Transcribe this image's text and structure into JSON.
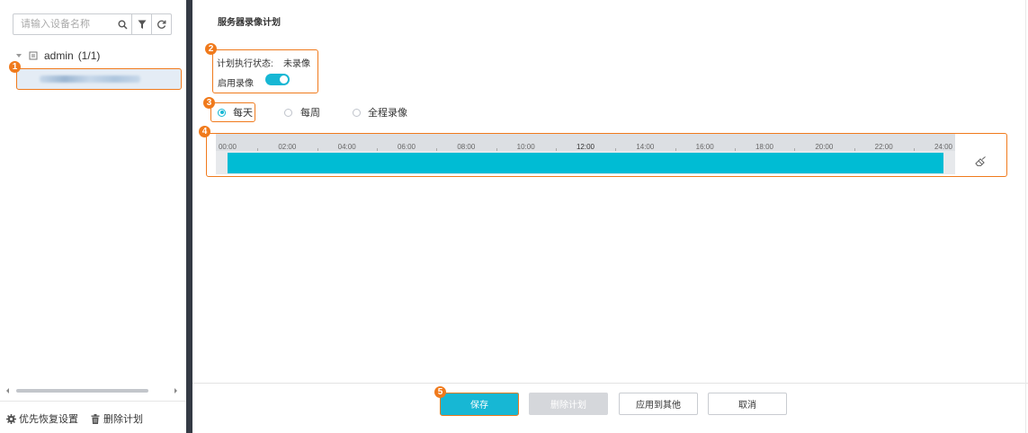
{
  "sidebar": {
    "search_placeholder": "请输入设备名称",
    "tree_root": {
      "user": "admin",
      "count": "(1/1)"
    },
    "footer": {
      "restore_label": "优先恢复设置",
      "delete_label": "删除计划"
    }
  },
  "main": {
    "title": "服务器录像计划",
    "status_label": "计划执行状态:",
    "status_value": "未录像",
    "enable_label": "启用录像",
    "enable_on": true,
    "radio_options": [
      "每天",
      "每周",
      "全程录像"
    ],
    "selected_option": "每天",
    "timeline_ticks": [
      "00:00",
      "02:00",
      "04:00",
      "06:00",
      "08:00",
      "10:00",
      "12:00",
      "14:00",
      "16:00",
      "18:00",
      "20:00",
      "22:00",
      "24:00"
    ],
    "recorded_range": {
      "start": "00:00",
      "end": "24:00"
    }
  },
  "buttons": {
    "save": "保存",
    "delete_plan": "删除计划",
    "apply_other": "应用到其他",
    "cancel": "取消"
  },
  "badges": [
    "1",
    "2",
    "3",
    "4",
    "5"
  ],
  "colors": {
    "accent": "#17b7d4",
    "timeline_fill": "#00bcd4",
    "highlight": "#f07a1c",
    "divider": "#343a44"
  }
}
